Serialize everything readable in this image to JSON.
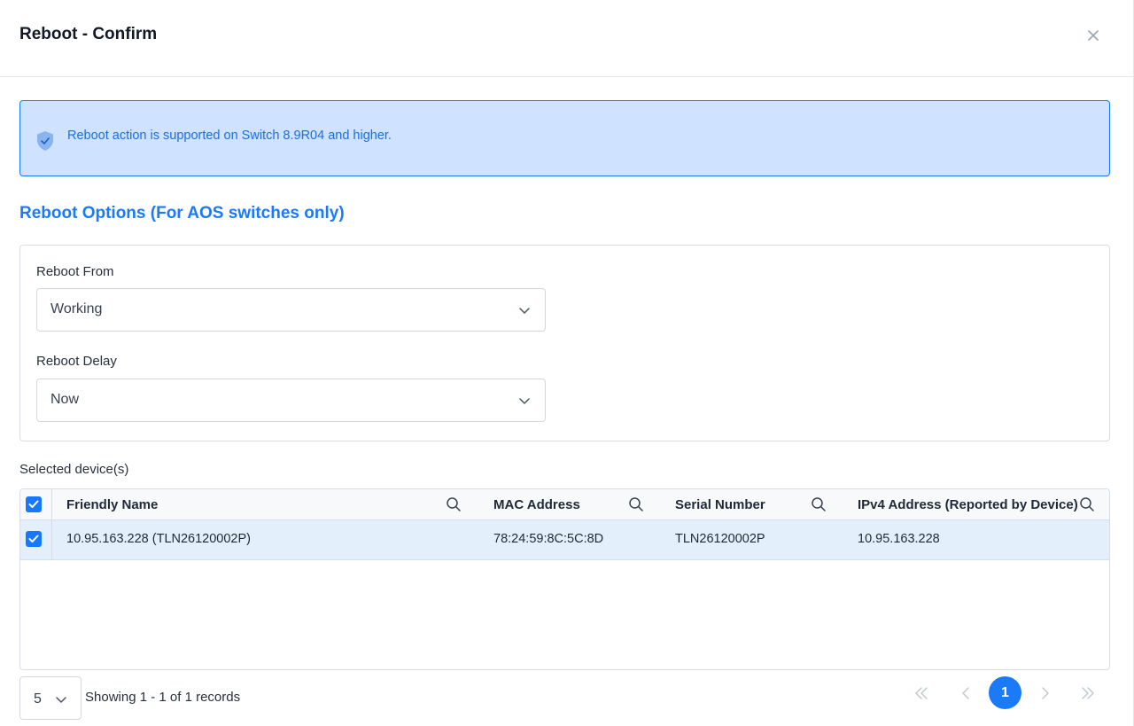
{
  "dialog": {
    "title": "Reboot - Confirm"
  },
  "alert": {
    "text": "Reboot action is supported on Switch 8.9R04 and higher."
  },
  "options": {
    "section_title": "Reboot Options (For AOS switches only)",
    "reboot_from": {
      "label": "Reboot From",
      "value": "Working"
    },
    "reboot_delay": {
      "label": "Reboot Delay",
      "value": "Now"
    }
  },
  "devices": {
    "label": "Selected device(s)",
    "columns": [
      "Friendly Name",
      "MAC Address",
      "Serial Number",
      "IPv4 Address (Reported by Device)"
    ],
    "rows": [
      {
        "selected": true,
        "friendly_name": "10.95.163.228 (TLN26120002P)",
        "mac": "78:24:59:8C:5C:8D",
        "serial": "TLN26120002P",
        "ipv4": "10.95.163.228"
      }
    ],
    "header_checkbox_checked": true
  },
  "pagination": {
    "page_size": "5",
    "summary": "Showing 1 - 1 of 1 records",
    "current_page": "1"
  },
  "colors": {
    "accent": "#1a7af8",
    "alert_bg": "#cfe2ff",
    "row_selected": "#e3f0fc"
  }
}
